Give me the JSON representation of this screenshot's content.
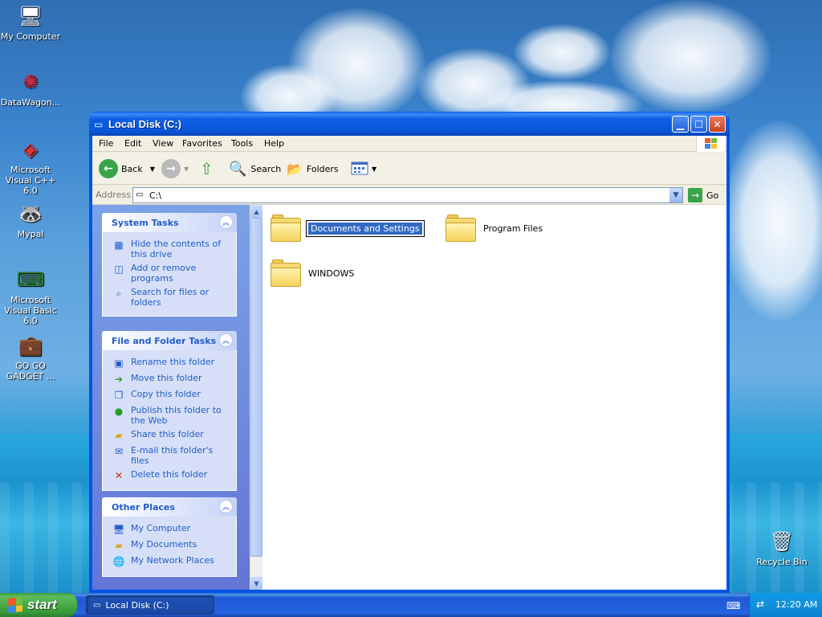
{
  "desktop": {
    "icons": [
      {
        "label": "My Computer",
        "icon": "my-computer-icon"
      },
      {
        "label": "DataWagon...",
        "icon": "datawagon-icon"
      },
      {
        "label": "Microsoft Visual C++ 6.0",
        "icon": "visual-cpp-icon"
      },
      {
        "label": "Mypal",
        "icon": "mypal-icon"
      },
      {
        "label": "Microsoft Visual Basic 6.0",
        "icon": "visual-basic-icon"
      },
      {
        "label": "GO GO GADGET ...",
        "icon": "briefcase-icon"
      },
      {
        "label": "Recycle Bin",
        "icon": "recycle-bin-icon"
      }
    ]
  },
  "window": {
    "title": "Local Disk (C:)",
    "menu": [
      "File",
      "Edit",
      "View",
      "Favorites",
      "Tools",
      "Help"
    ],
    "toolbar": {
      "back": "Back",
      "search": "Search",
      "folders": "Folders"
    },
    "address": {
      "label": "Address",
      "value": "C:\\",
      "go": "Go"
    },
    "task_panels": [
      {
        "title": "System Tasks",
        "tasks": [
          {
            "label": "Hide the contents of this drive",
            "icon": "hide-contents-icon"
          },
          {
            "label": "Add or remove programs",
            "icon": "add-remove-programs-icon"
          },
          {
            "label": "Search for files or folders",
            "icon": "search-icon"
          }
        ]
      },
      {
        "title": "File and Folder Tasks",
        "tasks": [
          {
            "label": "Rename this folder",
            "icon": "rename-icon"
          },
          {
            "label": "Move this folder",
            "icon": "move-icon"
          },
          {
            "label": "Copy this folder",
            "icon": "copy-icon"
          },
          {
            "label": "Publish this folder to the Web",
            "icon": "publish-web-icon"
          },
          {
            "label": "Share this folder",
            "icon": "share-icon"
          },
          {
            "label": "E-mail this folder's files",
            "icon": "email-icon"
          },
          {
            "label": "Delete this folder",
            "icon": "delete-icon"
          }
        ]
      },
      {
        "title": "Other Places",
        "tasks": [
          {
            "label": "My Computer",
            "icon": "my-computer-icon"
          },
          {
            "label": "My Documents",
            "icon": "my-documents-icon"
          },
          {
            "label": "My Network Places",
            "icon": "network-places-icon"
          }
        ]
      }
    ],
    "files": [
      {
        "name": "Documents and Settings",
        "selected": true
      },
      {
        "name": "Program Files",
        "selected": false
      },
      {
        "name": "WINDOWS",
        "selected": false
      }
    ]
  },
  "taskbar": {
    "start": "start",
    "task_button": "Local Disk (C:)",
    "clock": "12:20 AM"
  }
}
